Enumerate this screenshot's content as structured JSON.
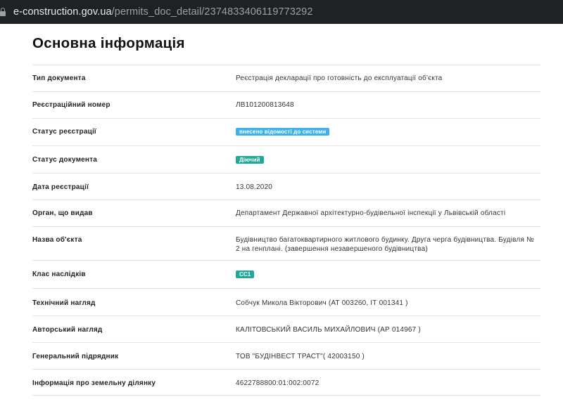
{
  "browser": {
    "url_host": "e-construction.gov.ua",
    "url_path": "/permits_doc_detail/2374833406119773292"
  },
  "page": {
    "title": "Основна інформація"
  },
  "info": {
    "doc_type": {
      "label": "Тип документа",
      "value": "Реєстрація декларації про готовність до експлуатації об'єкта"
    },
    "reg_number": {
      "label": "Реєстраційний номер",
      "value": "ЛВ101200813648"
    },
    "reg_status": {
      "label": "Статус реєстрації",
      "value": "внесено відомості до системи",
      "color": "#3bb2e8"
    },
    "doc_status": {
      "label": "Статус документа",
      "value": "Діючий",
      "color": "#20a99a"
    },
    "reg_date": {
      "label": "Дата реєстрації",
      "value": "13.08.2020"
    },
    "issuer": {
      "label": "Орган, що видав",
      "value": "Департамент Державної архітектурно-будівельної інспекції у Львівській області"
    },
    "object_name": {
      "label": "Назва об'єкта",
      "value": "Будівництво багатоквартирного житлового будинку. Друга черга будівництва. Будівля № 2 на генплані. (завершення незавершеного будівництва)"
    },
    "consequence_class": {
      "label": "Клас наслідків",
      "value": "СС1",
      "color": "#20a99a"
    },
    "tech_supervision": {
      "label": "Технічний нагляд",
      "value": "Собчук Микола Вікторович (АТ 003260, ІТ 001341 )"
    },
    "author_supervision": {
      "label": "Авторський нагляд",
      "value": "КАЛІТОВСЬКИЙ ВАСИЛЬ МИХАЙЛОВИЧ (АР 014967 )"
    },
    "general_contractor": {
      "label": "Генеральний підрядник",
      "value": "ТОВ \"БУДІНВЕСТ ТРАСТ\"( 42003150 )"
    },
    "land_info": {
      "label": "Інформація про земельну ділянку",
      "value": "4622788800:01:002:0072"
    }
  }
}
